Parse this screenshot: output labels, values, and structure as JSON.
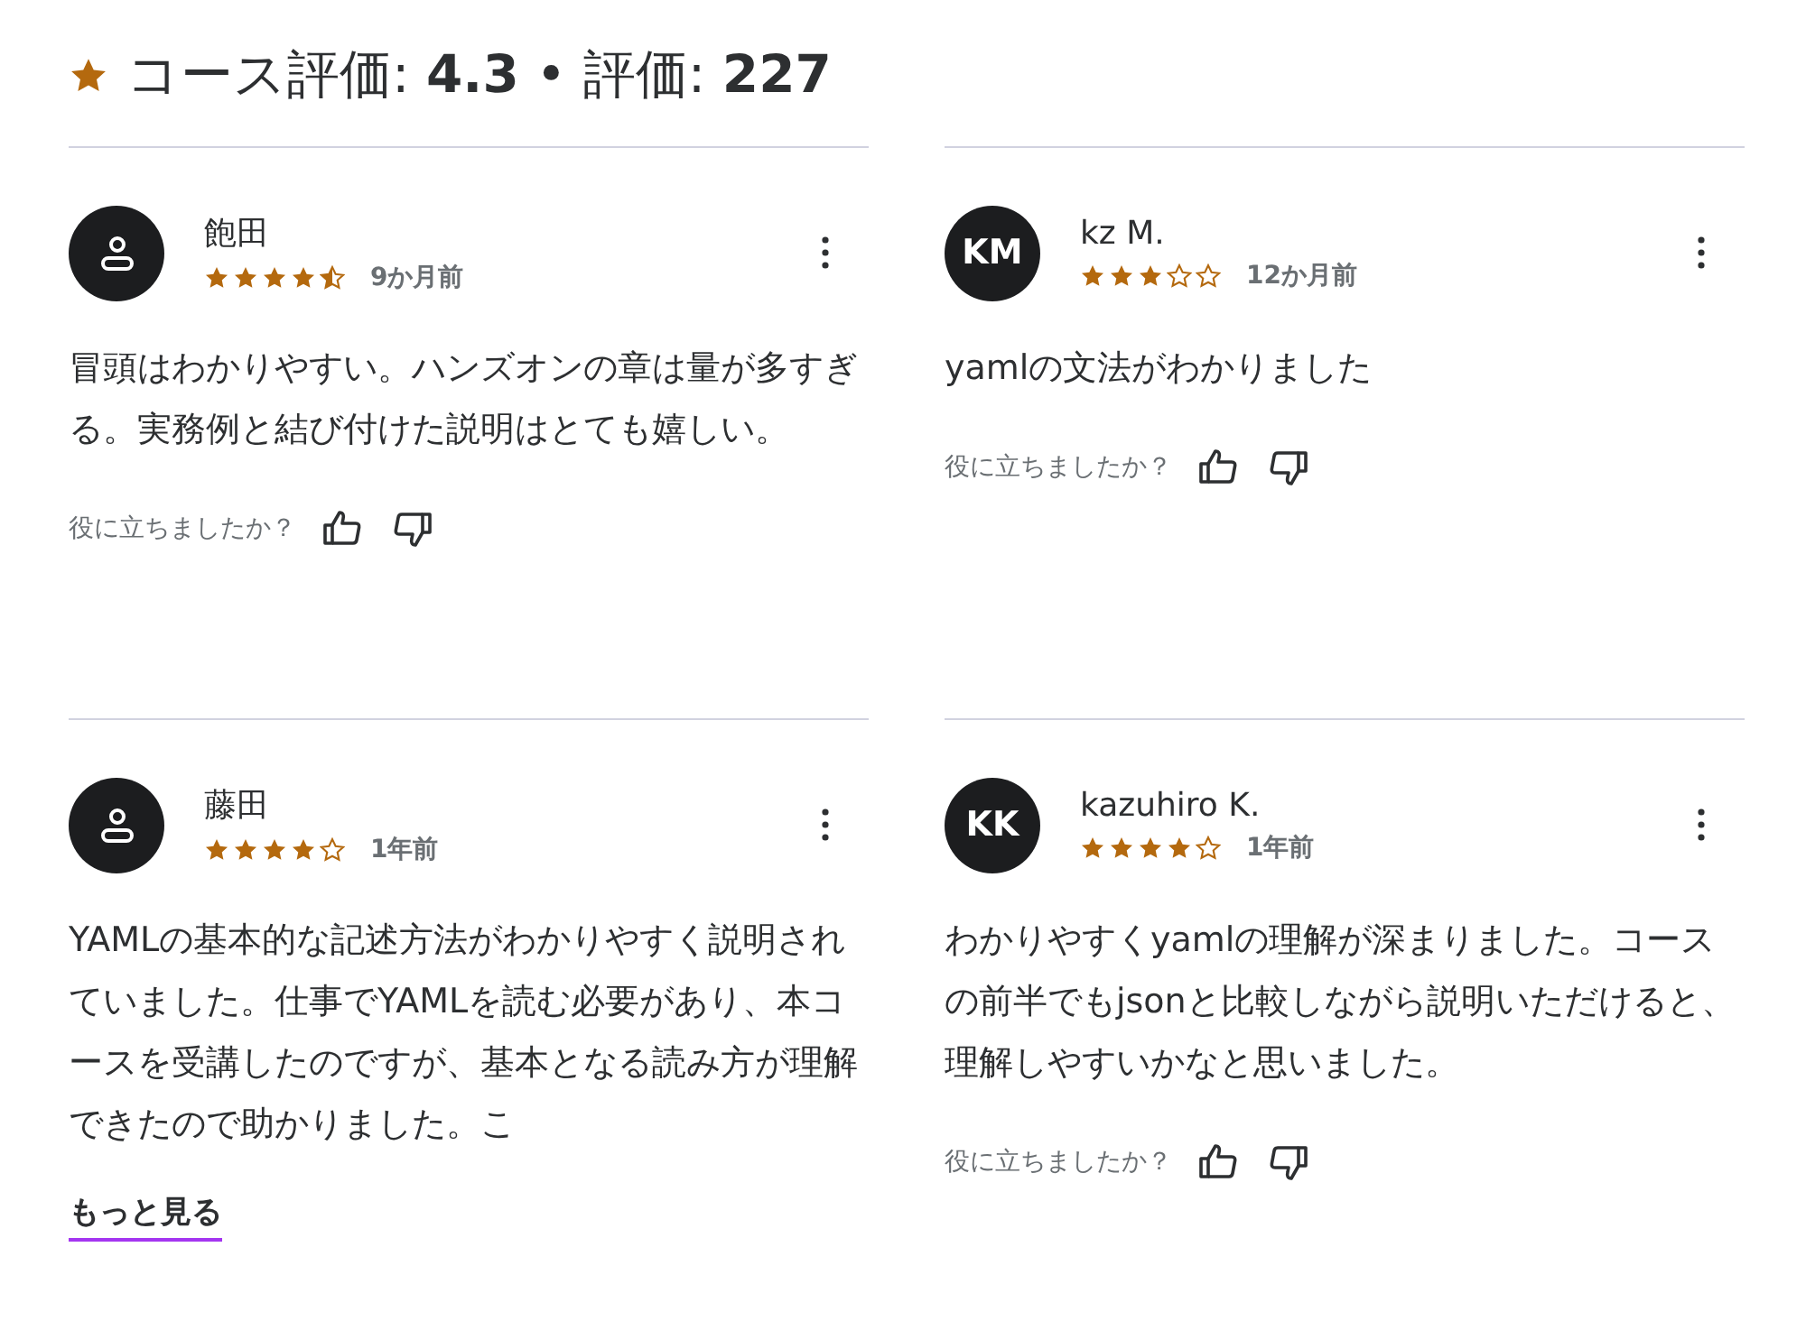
{
  "summary": {
    "text": "コース評価: **4.3** • 評価: **227**"
  },
  "reviews": [
    {
      "name": "飽田",
      "avatar": {
        "kind": "icon"
      },
      "stars": 4.5,
      "time": "9か月前",
      "body": "冒頭はわかりやすい。ハンズオンの章は量が多すぎる。実務例と結び付けた説明はとても嬉しい。",
      "helpful": "役に立ちましたか？"
    },
    {
      "name": "kz M.",
      "avatar": {
        "kind": "initials",
        "text": "KM"
      },
      "stars": 3,
      "time": "12か月前",
      "body": "yamlの文法がわかりました",
      "helpful": "役に立ちましたか？"
    },
    {
      "name": "藤田",
      "avatar": {
        "kind": "icon"
      },
      "stars": 4,
      "time": "1年前",
      "body": "YAMLの基本的な記述方法がわかりやすく説明されていました。仕事でYAMLを読む必要があり、本コースを受講したのですが、基本となる読み方が理解できたので助かりました。こ",
      "more": "もっと見る"
    },
    {
      "name": "kazuhiro K.",
      "avatar": {
        "kind": "initials",
        "text": "KK"
      },
      "stars": 4,
      "time": "1年前",
      "body": "わかりやすくyamlの理解が深まりました。コースの前半でもjsonと比較しながら説明いただけると、理解しやすいかなと思いました。",
      "helpful": "役に立ちましたか？"
    }
  ]
}
